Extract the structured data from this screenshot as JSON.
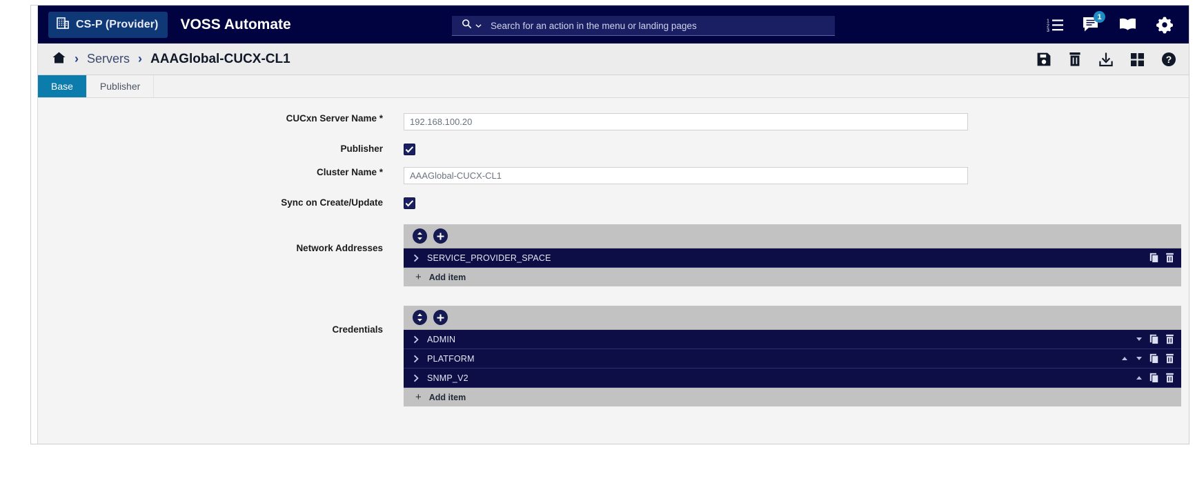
{
  "header": {
    "context_badge": {
      "label": "CS-P (Provider)",
      "icon": "building-icon"
    },
    "brand": "VOSS Automate",
    "search": {
      "placeholder": "Search for an action in the menu or landing pages",
      "value": "",
      "icon": "search-icon",
      "dropdown_icon": "chevron-down-icon"
    },
    "icons": [
      {
        "name": "numbered-list-icon",
        "badge": ""
      },
      {
        "name": "message-icon",
        "badge": "1"
      },
      {
        "name": "book-icon",
        "badge": ""
      },
      {
        "name": "gear-icon",
        "badge": ""
      }
    ],
    "colors": {
      "background": "#010340",
      "badge_accent": "#1e8bc3",
      "context_badge_bg": "#0f3876"
    }
  },
  "breadcrumb": {
    "home_icon": "home-icon",
    "separator": "›",
    "items": [
      {
        "label": "Servers",
        "current": false
      },
      {
        "label": "AAAGlobal-CUCX-CL1",
        "current": true
      }
    ],
    "tools": [
      {
        "name": "save-icon",
        "title": "Save"
      },
      {
        "name": "delete-icon",
        "title": "Delete"
      },
      {
        "name": "download-icon",
        "title": "Export"
      },
      {
        "name": "grid-icon",
        "title": "Actions"
      },
      {
        "name": "help-icon",
        "title": "Help"
      }
    ]
  },
  "tabs": [
    {
      "label": "Base",
      "active": true
    },
    {
      "label": "Publisher",
      "active": false
    }
  ],
  "form": {
    "fields": [
      {
        "label": "CUCxn Server Name *",
        "type": "text",
        "value": "192.168.100.20",
        "placeholder": ""
      },
      {
        "label": "Publisher",
        "type": "checkbox",
        "checked": true
      },
      {
        "label": "Cluster Name *",
        "type": "text",
        "value": "AAAGlobal-CUCX-CL1",
        "placeholder": ""
      },
      {
        "label": "Sync on Create/Update",
        "type": "checkbox",
        "checked": true
      }
    ],
    "groups": [
      {
        "label": "Network Addresses",
        "sort_icon": "sort-updown-icon",
        "add_icon": "plus-circle-icon",
        "add_item_label": "Add item",
        "items": [
          {
            "name": "SERVICE_PROVIDER_SPACE",
            "chevron_icon": "chevron-right-icon",
            "move_up": false,
            "move_down": false,
            "copy_icon": "copy-icon",
            "delete_icon": "trash-icon"
          }
        ]
      },
      {
        "label": "Credentials",
        "sort_icon": "sort-updown-icon",
        "add_icon": "plus-circle-icon",
        "add_item_label": "Add item",
        "items": [
          {
            "name": "ADMIN",
            "chevron_icon": "chevron-right-icon",
            "move_up": false,
            "move_down": true,
            "copy_icon": "copy-icon",
            "delete_icon": "trash-icon"
          },
          {
            "name": "PLATFORM",
            "chevron_icon": "chevron-right-icon",
            "move_up": true,
            "move_down": true,
            "copy_icon": "copy-icon",
            "delete_icon": "trash-icon"
          },
          {
            "name": "SNMP_V2",
            "chevron_icon": "chevron-right-icon",
            "move_up": true,
            "move_down": false,
            "copy_icon": "copy-icon",
            "delete_icon": "trash-icon"
          }
        ]
      }
    ]
  }
}
